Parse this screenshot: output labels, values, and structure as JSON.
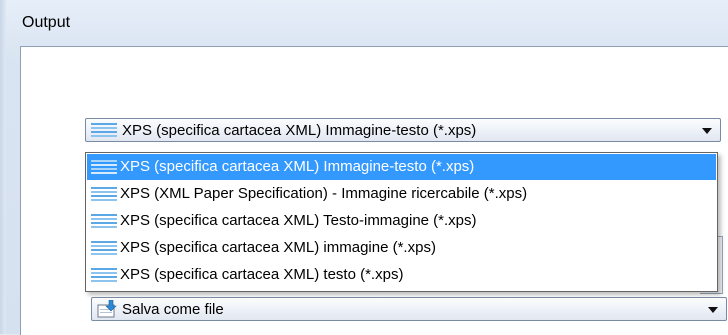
{
  "panel": {
    "title": "Output"
  },
  "format_combo": {
    "value": "XPS (specifica cartacea XML) Immagine-testo (*.xps)",
    "icon": "xps-document-icon"
  },
  "format_options": [
    {
      "label": "XPS (specifica cartacea XML) Immagine-testo (*.xps)",
      "selected": true
    },
    {
      "label": "XPS (XML Paper Specification) - Immagine ricercabile (*.xps)",
      "selected": false
    },
    {
      "label": "XPS (specifica cartacea XML) Testo-immagine (*.xps)",
      "selected": false
    },
    {
      "label": "XPS (specifica cartacea XML) immagine (*.xps)",
      "selected": false
    },
    {
      "label": "XPS (specifica cartacea XML) testo (*.xps)",
      "selected": false
    }
  ],
  "save_combo": {
    "value": "Salva come file",
    "icon": "save-to-file-icon"
  },
  "colors": {
    "selection": "#3399ff",
    "selection_text": "#ffffff",
    "icon_stripe": "#5aa9e6"
  }
}
